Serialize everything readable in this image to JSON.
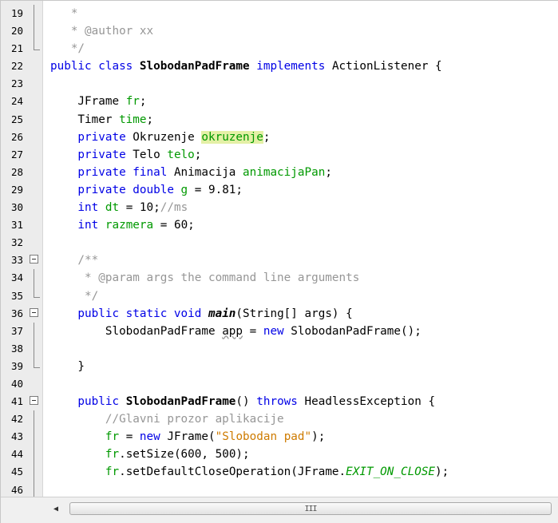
{
  "editor": {
    "lines": [
      {
        "n": "19",
        "tokens": [
          {
            "t": "   *",
            "c": "cm"
          }
        ]
      },
      {
        "n": "20",
        "tokens": [
          {
            "t": "   * @author xx",
            "c": "cm"
          }
        ]
      },
      {
        "n": "21",
        "tokens": [
          {
            "t": "   */",
            "c": "cm"
          }
        ]
      },
      {
        "n": "22",
        "tokens": [
          {
            "t": "public class ",
            "c": "kw"
          },
          {
            "t": "SlobodanPadFrame",
            "c": "bold"
          },
          {
            "t": " implements ",
            "c": "kw"
          },
          {
            "t": "ActionListener {",
            "c": ""
          }
        ]
      },
      {
        "n": "23",
        "tokens": []
      },
      {
        "n": "24",
        "tokens": [
          {
            "t": "    JFrame ",
            "c": ""
          },
          {
            "t": "fr",
            "c": "fld"
          },
          {
            "t": ";",
            "c": ""
          }
        ]
      },
      {
        "n": "25",
        "tokens": [
          {
            "t": "    Timer ",
            "c": ""
          },
          {
            "t": "time",
            "c": "fld"
          },
          {
            "t": ";",
            "c": ""
          }
        ]
      },
      {
        "n": "26",
        "tokens": [
          {
            "t": "    private ",
            "c": "kw"
          },
          {
            "t": "Okruzenje ",
            "c": ""
          },
          {
            "t": "okruzenje",
            "c": "fld hl"
          },
          {
            "t": ";",
            "c": ""
          }
        ]
      },
      {
        "n": "27",
        "tokens": [
          {
            "t": "    private ",
            "c": "kw"
          },
          {
            "t": "Telo ",
            "c": ""
          },
          {
            "t": "telo",
            "c": "fld"
          },
          {
            "t": ";",
            "c": ""
          }
        ]
      },
      {
        "n": "28",
        "tokens": [
          {
            "t": "    private final ",
            "c": "kw"
          },
          {
            "t": "Animacija ",
            "c": ""
          },
          {
            "t": "animacijaPan",
            "c": "fld"
          },
          {
            "t": ";",
            "c": ""
          }
        ]
      },
      {
        "n": "29",
        "tokens": [
          {
            "t": "    private double ",
            "c": "kw"
          },
          {
            "t": "g",
            "c": "fld"
          },
          {
            "t": " = 9.81;",
            "c": ""
          }
        ]
      },
      {
        "n": "30",
        "tokens": [
          {
            "t": "    int ",
            "c": "kw"
          },
          {
            "t": "dt",
            "c": "fld"
          },
          {
            "t": " = 10;",
            "c": ""
          },
          {
            "t": "//ms",
            "c": "cm"
          }
        ]
      },
      {
        "n": "31",
        "tokens": [
          {
            "t": "    int ",
            "c": "kw"
          },
          {
            "t": "razmera",
            "c": "fld"
          },
          {
            "t": " = 60;",
            "c": ""
          }
        ]
      },
      {
        "n": "32",
        "tokens": []
      },
      {
        "n": "33",
        "tokens": [
          {
            "t": "    /**",
            "c": "cm"
          }
        ]
      },
      {
        "n": "34",
        "tokens": [
          {
            "t": "     * @param args the command line arguments",
            "c": "cm"
          }
        ]
      },
      {
        "n": "35",
        "tokens": [
          {
            "t": "     */",
            "c": "cm"
          }
        ]
      },
      {
        "n": "36",
        "tokens": [
          {
            "t": "    public static void ",
            "c": "kw"
          },
          {
            "t": "main",
            "c": "bold ital"
          },
          {
            "t": "(String[] args) {",
            "c": ""
          }
        ]
      },
      {
        "n": "37",
        "tokens": [
          {
            "t": "        SlobodanPadFrame ",
            "c": ""
          },
          {
            "t": "app",
            "c": "squig"
          },
          {
            "t": " = ",
            "c": ""
          },
          {
            "t": "new ",
            "c": "kw"
          },
          {
            "t": "SlobodanPadFrame();",
            "c": ""
          }
        ]
      },
      {
        "n": "38",
        "tokens": []
      },
      {
        "n": "39",
        "tokens": [
          {
            "t": "    }",
            "c": ""
          }
        ]
      },
      {
        "n": "40",
        "tokens": []
      },
      {
        "n": "41",
        "tokens": [
          {
            "t": "    public ",
            "c": "kw"
          },
          {
            "t": "SlobodanPadFrame",
            "c": "bold"
          },
          {
            "t": "() ",
            "c": ""
          },
          {
            "t": "throws ",
            "c": "kw"
          },
          {
            "t": "HeadlessException {",
            "c": ""
          }
        ]
      },
      {
        "n": "42",
        "tokens": [
          {
            "t": "        //Glavni prozor aplikacije",
            "c": "cm"
          }
        ]
      },
      {
        "n": "43",
        "tokens": [
          {
            "t": "        ",
            "c": ""
          },
          {
            "t": "fr",
            "c": "fld"
          },
          {
            "t": " = ",
            "c": ""
          },
          {
            "t": "new ",
            "c": "kw"
          },
          {
            "t": "JFrame(",
            "c": ""
          },
          {
            "t": "\"Slobodan pad\"",
            "c": "str"
          },
          {
            "t": ");",
            "c": ""
          }
        ]
      },
      {
        "n": "44",
        "tokens": [
          {
            "t": "        ",
            "c": ""
          },
          {
            "t": "fr",
            "c": "fld"
          },
          {
            "t": ".setSize(600, 500);",
            "c": ""
          }
        ]
      },
      {
        "n": "45",
        "tokens": [
          {
            "t": "        ",
            "c": ""
          },
          {
            "t": "fr",
            "c": "fld"
          },
          {
            "t": ".setDefaultCloseOperation(JFrame.",
            "c": ""
          },
          {
            "t": "EXIT_ON_CLOSE",
            "c": "fld ital"
          },
          {
            "t": ");",
            "c": ""
          }
        ]
      },
      {
        "n": "46",
        "tokens": []
      }
    ],
    "folds": {
      "33": "start",
      "34": "mid",
      "35": "end",
      "36": "start",
      "37": "mid",
      "38": "mid",
      "39": "end",
      "41": "start",
      "42": "mid",
      "43": "mid",
      "44": "mid",
      "45": "mid",
      "46": "mid",
      "19": "mid",
      "20": "mid",
      "21": "end"
    }
  },
  "scrollbar": {
    "left_arrow": "◀",
    "grip": "III"
  }
}
